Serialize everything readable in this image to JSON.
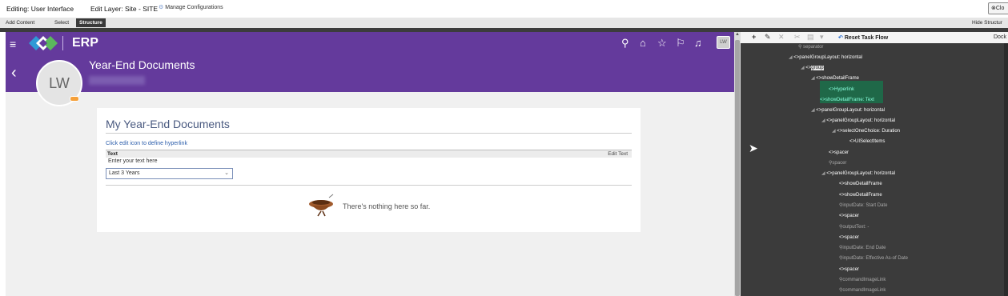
{
  "topbar": {
    "editing": "Editing: User Interface",
    "edit_layer": "Edit Layer: Site - SITE",
    "manage": "Manage Configurations",
    "close": "Clo"
  },
  "tabs": [
    "Add Content",
    "Select",
    "Structure"
  ],
  "hide_structure": "Hide Structur",
  "app": {
    "brand": "ERP",
    "page_title": "Year-End Documents",
    "avatar": "LW",
    "header_badge": "LW",
    "card": {
      "title": "My Year-End Documents",
      "hyperlink": "Click edit icon to define hyperlink",
      "col_text": "Text",
      "col_edit": "Edit Text",
      "text_value": "Enter your text here",
      "select_value": "Last 3 Years",
      "empty": "There's nothing here so far."
    }
  },
  "panel": {
    "reset": "Reset Task Flow",
    "dock": "Dock",
    "nodes": [
      {
        "label": "separator",
        "gray": true
      },
      {
        "label": "panelGroupLayout: horizontal"
      },
      {
        "label": "group"
      },
      {
        "label": "showDetailFrame"
      },
      {
        "label": "Hyperlink"
      },
      {
        "label": "showDetailFrame: Text"
      },
      {
        "label": "panelGroupLayout: horizontal"
      },
      {
        "label": "panelGroupLayout: horizontal"
      },
      {
        "label": "selectOneChoice: Duration"
      },
      {
        "label": "UISelectItems"
      },
      {
        "label": "spacer"
      },
      {
        "label": "spacer",
        "gray": true
      },
      {
        "label": "panelGroupLayout: horizontal"
      },
      {
        "label": "showDetailFrame"
      },
      {
        "label": "showDetailFrame"
      },
      {
        "label": "inputDate: Start Date",
        "gray": true
      },
      {
        "label": "spacer"
      },
      {
        "label": "outputText: -",
        "gray": true
      },
      {
        "label": "spacer"
      },
      {
        "label": "inputDate: End Date",
        "gray": true
      },
      {
        "label": "inputDate: Effective As-of Date",
        "gray": true
      },
      {
        "label": "spacer"
      },
      {
        "label": "commandImageLink",
        "gray": true
      },
      {
        "label": "commandImageLink",
        "gray": true
      }
    ]
  },
  "colors": {
    "header": "#643a9c",
    "panel": "#3b3b3b",
    "highlight": "#1f6848"
  }
}
